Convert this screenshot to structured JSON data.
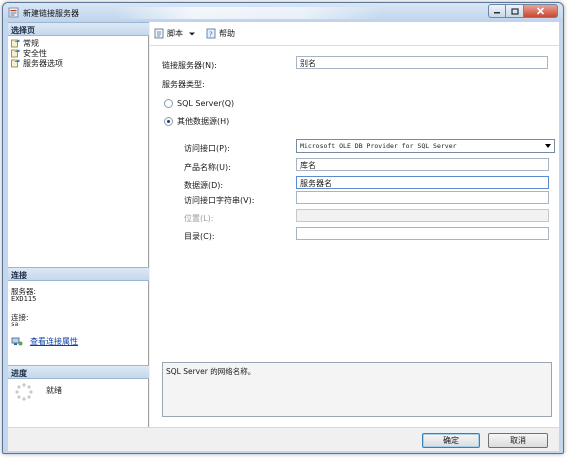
{
  "window": {
    "title": "新建链接服务器",
    "controls": {
      "minimize": "–",
      "maximize": "□",
      "close": "✕"
    }
  },
  "left_pane": {
    "select_page_header": "选择页",
    "pages": [
      {
        "label": "常规",
        "icon": "page-icon"
      },
      {
        "label": "安全性",
        "icon": "page-icon"
      },
      {
        "label": "服务器选项",
        "icon": "page-icon"
      }
    ],
    "connection": {
      "header": "连接",
      "server_label": "服务器:",
      "server_value": "EXD115",
      "connection_label": "连接:",
      "connection_value": "sa",
      "view_properties_link": "查看连接属性"
    },
    "progress": {
      "header": "进度",
      "status": "就绪"
    }
  },
  "toolbar": {
    "script_label": "脚本",
    "help_label": "帮助"
  },
  "form": {
    "linked_server_label": "链接服务器(N):",
    "linked_server_value": "别名",
    "server_type_label": "服务器类型:",
    "sql_server_option": "SQL Server(Q)",
    "other_source_option": "其他数据源(H)",
    "selected_server_type": "other",
    "provider_label": "访问接口(P):",
    "provider_value": "Microsoft OLE DB Provider for SQL Server",
    "product_name_label": "产品名称(U):",
    "product_name_value": "库名",
    "data_source_label": "数据源(D):",
    "data_source_value": "服务器名",
    "provider_string_label": "访问接口字符串(V):",
    "provider_string_value": "",
    "location_label": "位置(L):",
    "location_value": "",
    "catalog_label": "目录(C):",
    "catalog_value": ""
  },
  "description": "SQL Server 的网络名称。",
  "buttons": {
    "ok": "确定",
    "cancel": "取消"
  },
  "colors": {
    "section_header": "#c6d8ec",
    "link": "#0a3fa8",
    "close_button": "#c8472f"
  }
}
